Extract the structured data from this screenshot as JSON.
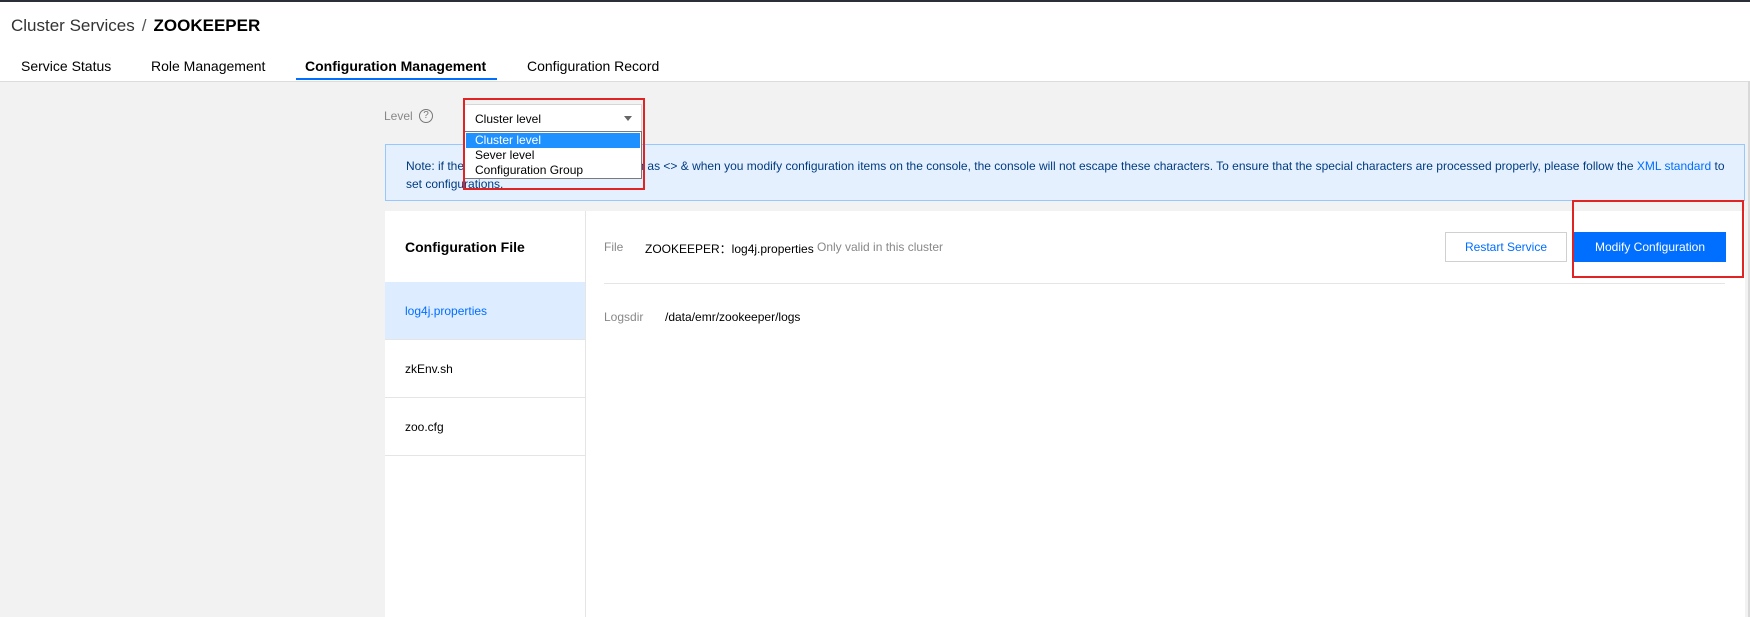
{
  "breadcrumb": {
    "parent": "Cluster Services",
    "separator": "/",
    "current": "ZOOKEEPER"
  },
  "tabs": [
    {
      "label": "Service Status",
      "active": false
    },
    {
      "label": "Role Management",
      "active": false
    },
    {
      "label": "Configuration Management",
      "active": true
    },
    {
      "label": "Configuration Record",
      "active": false
    }
  ],
  "level": {
    "label": "Level",
    "help_icon": "question-circle-icon",
    "selected": "Cluster level",
    "options": [
      "Cluster level",
      "Sever level",
      "Configuration Group"
    ]
  },
  "note": {
    "line1_start": "Note: if the",
    "line1_rest": "such as <> & when you modify configuration items on the console, the console will not escape these characters. To ensure that the special characters are processed properly, please follow the",
    "link_xml": "XML",
    "link_standard": "standard",
    "line2_rest": "to set configurations."
  },
  "config_files": {
    "heading": "Configuration File",
    "items": [
      {
        "label": "log4j.properties",
        "active": true
      },
      {
        "label": "zkEnv.sh",
        "active": false
      },
      {
        "label": "zoo.cfg",
        "active": false
      }
    ]
  },
  "file_detail": {
    "file_label": "File",
    "file_name": "ZOOKEEPER：log4j.properties",
    "scope_note": "Only valid in this cluster",
    "restart_button": "Restart Service",
    "modify_button": "Modify Configuration",
    "params": [
      {
        "key": "Logsdir",
        "value": "/data/emr/zookeeper/logs"
      }
    ]
  },
  "colors": {
    "accent": "#006eff",
    "highlight": "#e02424",
    "note_bg": "#e5f0ff",
    "selected_option": "#1e90ff"
  }
}
